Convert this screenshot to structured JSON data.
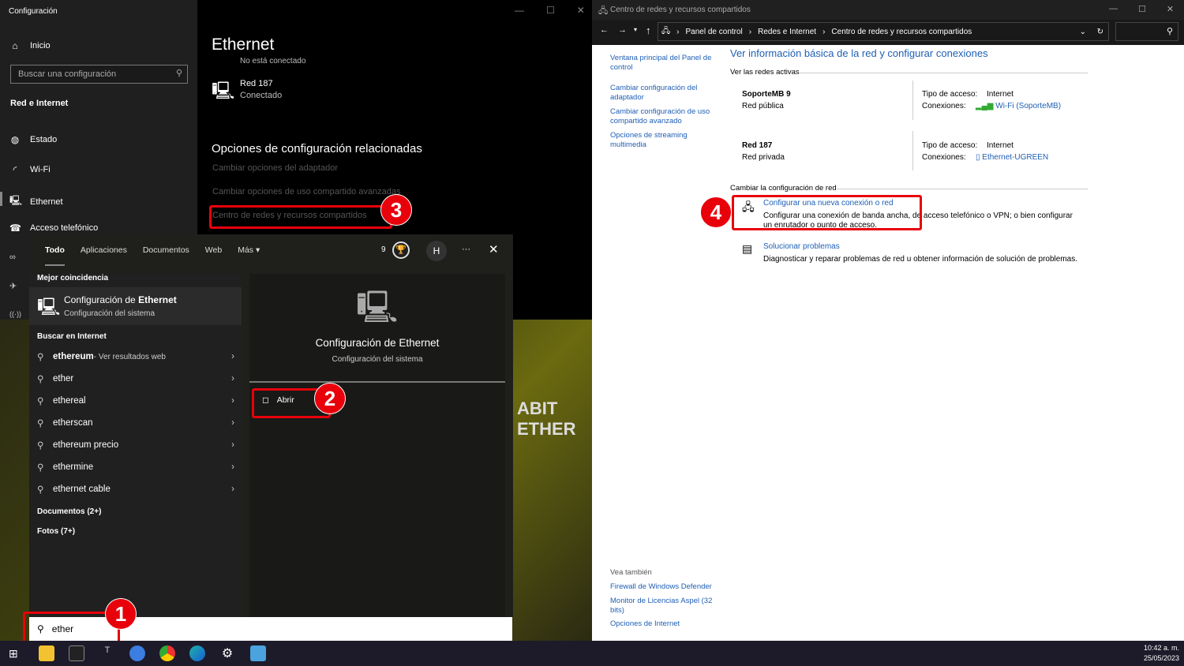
{
  "settings": {
    "title": "Configuración",
    "home": "Inicio",
    "search_placeholder": "Buscar una configuración",
    "section": "Red e Internet",
    "nav": [
      {
        "label": "Estado",
        "icon": "globe-icon"
      },
      {
        "label": "Wi-Fi",
        "icon": "wifi-icon"
      },
      {
        "label": "Ethernet",
        "icon": "ethernet-icon"
      },
      {
        "label": "Acceso telefónico",
        "icon": "dialup-icon"
      }
    ],
    "page_title": "Ethernet",
    "prev_status": "No está conectado",
    "network_name": "Red 187",
    "network_status": "Conectado",
    "related_title": "Opciones de configuración relacionadas",
    "related_links": [
      "Cambiar opciones del adaptador",
      "Cambiar opciones de uso compartido avanzadas",
      "Centro de redes y recursos compartidos"
    ]
  },
  "search": {
    "tabs": [
      "Todo",
      "Aplicaciones",
      "Documentos",
      "Web",
      "Más"
    ],
    "points": "9",
    "avatar": "H",
    "more": "···",
    "best_header": "Mejor coincidencia",
    "best_title_pre": "Configuración de ",
    "best_title_bold": "Ethernet",
    "best_sub": "Configuración del sistema",
    "web_header": "Buscar en Internet",
    "web_suffix": " - Ver resultados web",
    "results": [
      "ethereum",
      "ether",
      "ethereal",
      "etherscan",
      "ethereum precio",
      "ethermine",
      "ethernet cable"
    ],
    "docs": "Documentos (2+)",
    "photos": "Fotos (7+)",
    "preview_title": "Configuración de Ethernet",
    "preview_sub": "Configuración del sistema",
    "open": "Abrir",
    "query": "ether"
  },
  "control_panel": {
    "title": "Centro de redes y recursos compartidos",
    "breadcrumb": [
      "Panel de control",
      "Redes e Internet",
      "Centro de redes y recursos compartidos"
    ],
    "side_links": [
      "Ventana principal del Panel de control",
      "Cambiar configuración del adaptador",
      "Cambiar configuración de uso compartido avanzado",
      "Opciones de streaming multimedia"
    ],
    "heading": "Ver información básica de la red y configurar conexiones",
    "active_label": "Ver las redes activas",
    "access_label": "Tipo de acceso:",
    "conn_label": "Conexiones:",
    "networks": [
      {
        "name": "SoporteMB 9",
        "type": "Red pública",
        "access": "Internet",
        "connection": "Wi-Fi (SoporteMB)"
      },
      {
        "name": "Red 187",
        "type": "Red privada",
        "access": "Internet",
        "connection": "Ethernet-UGREEN"
      }
    ],
    "change_label": "Cambiar la configuración de red",
    "tasks": [
      {
        "title": "Configurar una nueva conexión o red",
        "desc": "Configurar una conexión de banda ancha, de acceso telefónico o VPN; o bien configurar un enrutador o punto de acceso."
      },
      {
        "title": "Solucionar problemas",
        "desc": "Diagnosticar y reparar problemas de red u obtener información de solución de problemas."
      }
    ],
    "see_also": "Vea también",
    "see_links": [
      "Firewall de Windows Defender",
      "Monitor de Licencias Aspel (32 bits)",
      "Opciones de Internet"
    ]
  },
  "annotations": [
    "1",
    "2",
    "3",
    "4"
  ],
  "taskbar": {
    "time": "10:42 a. m.",
    "date": "25/05/2023"
  },
  "colors": {
    "annotation": "#e8000b",
    "link": "#1f5fb5"
  }
}
